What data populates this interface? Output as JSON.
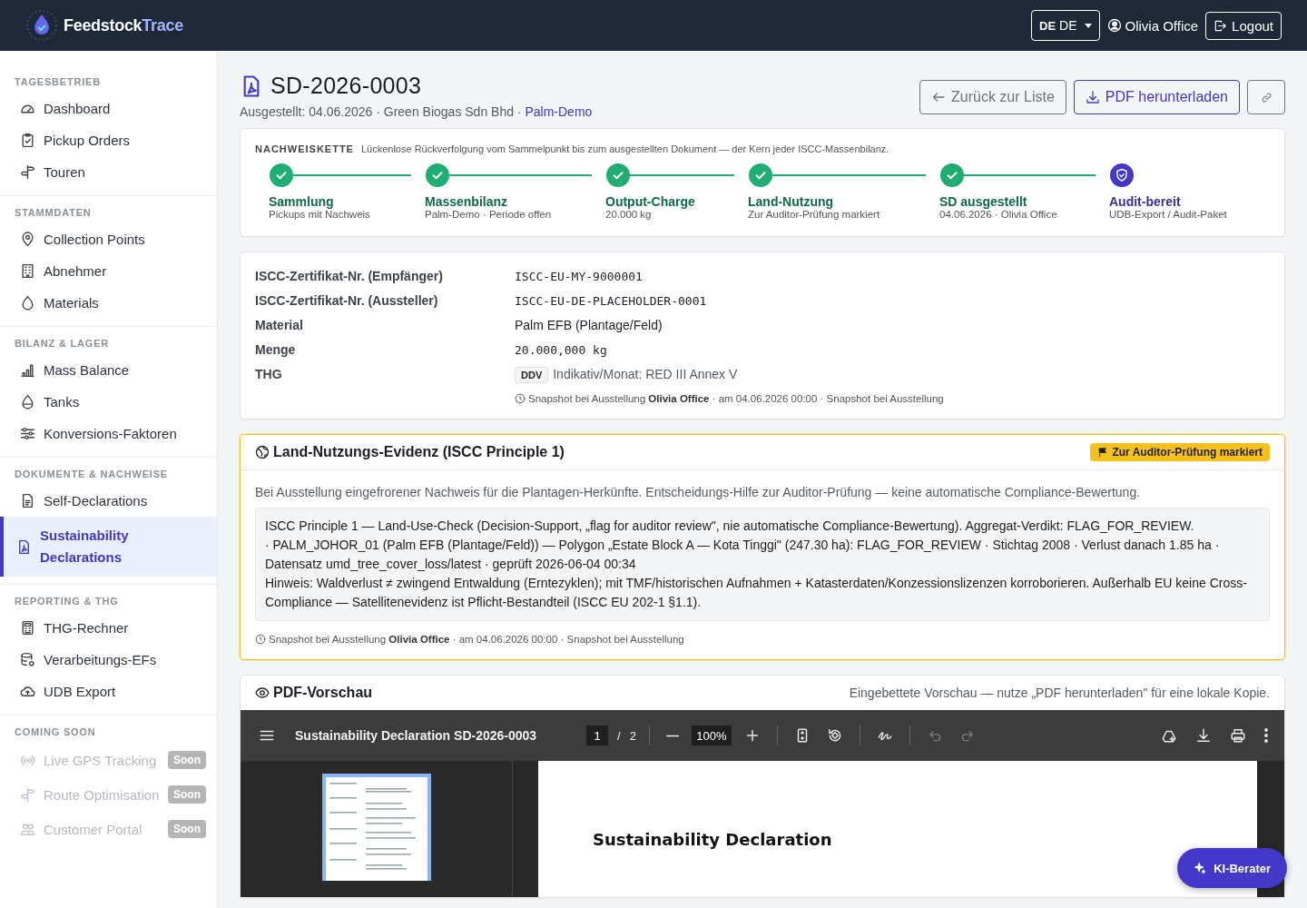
{
  "header": {
    "logo_prefix": "Feedstock",
    "logo_suffix": "Trace",
    "language": {
      "flag": "DE",
      "code": "DE"
    },
    "user": "Olivia Office",
    "logout": "Logout"
  },
  "sidebar": {
    "sections": [
      {
        "label": "TAGESBETRIEB",
        "items": [
          {
            "label": "Dashboard",
            "selected": false,
            "disabled": false
          },
          {
            "label": "Pickup Orders",
            "selected": false,
            "disabled": false
          },
          {
            "label": "Touren",
            "selected": false,
            "disabled": false
          }
        ]
      },
      {
        "label": "STAMMDATEN",
        "items": [
          {
            "label": "Collection Points",
            "selected": false,
            "disabled": false
          },
          {
            "label": "Abnehmer",
            "selected": false,
            "disabled": false
          },
          {
            "label": "Materials",
            "selected": false,
            "disabled": false
          }
        ]
      },
      {
        "label": "BILANZ & LAGER",
        "items": [
          {
            "label": "Mass Balance",
            "selected": false,
            "disabled": false
          },
          {
            "label": "Tanks",
            "selected": false,
            "disabled": false
          },
          {
            "label": "Konversions-Faktoren",
            "selected": false,
            "disabled": false
          }
        ]
      },
      {
        "label": "DOKUMENTE & NACHWEISE",
        "items": [
          {
            "label": "Self-Declarations",
            "selected": false,
            "disabled": false
          },
          {
            "label": "Sustainability Declarations",
            "selected": true,
            "disabled": false
          }
        ]
      },
      {
        "label": "REPORTING & THG",
        "items": [
          {
            "label": "THG-Rechner",
            "selected": false,
            "disabled": false
          },
          {
            "label": "Verarbeitungs-EFs",
            "selected": false,
            "disabled": false
          },
          {
            "label": "UDB Export",
            "selected": false,
            "disabled": false
          }
        ]
      },
      {
        "label": "COMING SOON",
        "items": [
          {
            "label": "Live GPS Tracking",
            "selected": false,
            "disabled": true,
            "badge": "Soon"
          },
          {
            "label": "Route Optimisation",
            "selected": false,
            "disabled": true,
            "badge": "Soon"
          },
          {
            "label": "Customer Portal",
            "selected": false,
            "disabled": true,
            "badge": "Soon"
          }
        ]
      }
    ]
  },
  "page": {
    "title": "SD-2026-0003",
    "subtitle": "Ausgestellt: 04.06.2026 · Green Biogas Sdn Bhd · ",
    "subtitle_link": "Palm-Demo",
    "buttons": [
      {
        "kind": "back",
        "label": "Zurück zur Liste"
      },
      {
        "kind": "download",
        "label": "PDF herunterladen"
      },
      {
        "kind": "link"
      }
    ]
  },
  "chain": {
    "label": "NACHWEISKETTE",
    "description": "Lückenlose Rückverfolgung vom Sammelpunkt bis zum ausgestellten Dokument — der Kern jeder ISCC-Massenbilanz.",
    "steps": [
      {
        "title": "Sammlung",
        "subtitle": "Pickups mit Nachweis",
        "done": true
      },
      {
        "title": "Massenbilanz",
        "subtitle": "Palm-Demo · Periode offen",
        "done": true
      },
      {
        "title": "Output-Charge",
        "subtitle": "20.000 kg",
        "done": true
      },
      {
        "title": "Land-Nutzung",
        "subtitle": "Zur Auditor-Prüfung markiert",
        "done": true
      },
      {
        "title": "SD ausgestellt",
        "subtitle": "04.06.2026 · Olivia Office",
        "done": true
      },
      {
        "title": "Audit-bereit",
        "subtitle": "UDB-Export / Audit-Paket",
        "done": false
      }
    ]
  },
  "details": {
    "rows": [
      {
        "label": "ISCC-Zertifikat-Nr. (Empfänger)",
        "kind": "mono",
        "value": "ISCC-EU-MY-9000001"
      },
      {
        "label": "ISCC-Zertifikat-Nr. (Aussteller)",
        "kind": "mono",
        "value": "ISCC-EU-DE-PLACEHOLDER-0001"
      },
      {
        "label": "Material",
        "kind": "text",
        "value": "Palm EFB (Plantage/Feld)"
      },
      {
        "label": "Menge",
        "kind": "mono",
        "value": "20.000,000 kg"
      },
      {
        "label": "THG",
        "kind": "badge",
        "badge": "DDV",
        "value": "Indikativ/Monat: RED III Annex V"
      }
    ],
    "note": "Snapshot bei Ausstellung **Olivia Office** · am 04.06.2026 00:00 · Snapshot bei Ausstellung"
  },
  "land_use": {
    "title": "Land-Nutzungs-Evidenz (ISCC Principle 1)",
    "flag": "Zur Auditor-Prüfung markiert",
    "intro": "Bei Ausstellung eingefrorener Nachweis für die Plantagen-Herkünfte. Entscheidungs-Hilfe zur Auditor-Prüfung — keine automatische Compliance-Bewertung.",
    "lines": [
      "ISCC Principle 1 — Land-Use-Check (Decision-Support, „flag for auditor review\", nie automatische Compliance-Bewertung). Aggregat-Verdikt: FLAG_FOR_REVIEW.",
      "· PALM_JOHOR_01 (Palm EFB (Plantage/Feld)) — Polygon „Estate Block A — Kota Tinggi\" (247.30 ha): FLAG_FOR_REVIEW · Stichtag 2008 · Verlust danach 1.85 ha · Datensatz umd_tree_cover_loss/latest · geprüft 2026-06-04 00:34",
      "Hinweis: Waldverlust ≠ zwingend Entwaldung (Erntezyklen); mit TMF/historischen Aufnahmen + Katasterdaten/Konzessionslizenzen korroborieren. Außerhalb EU keine Cross-Compliance — Satellitenevidenz ist Pflicht-Bestandteil (ISCC EU 202-1 §1.1)."
    ],
    "note": "Snapshot bei Ausstellung **Olivia Office** · am 04.06.2026 00:00 · Snapshot bei Ausstellung"
  },
  "pdf": {
    "title": "PDF-Vorschau",
    "hint": "Eingebettete Vorschau — nutze „PDF herunterladen\" für eine lokale Kopie.",
    "viewer": {
      "document": "Sustainability Declaration SD-2026-0003",
      "page": "1",
      "separator": "/",
      "pages": "2",
      "zoom": "100%",
      "heading": "Sustainability Declaration"
    }
  },
  "assistant": {
    "label": "KI-Berater"
  }
}
